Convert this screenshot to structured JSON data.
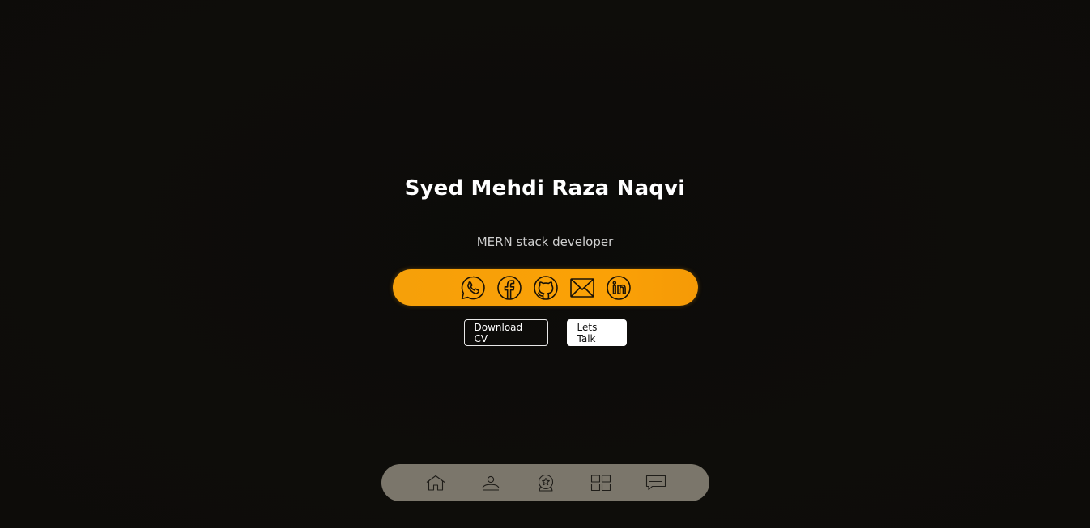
{
  "hero": {
    "name": "Syed Mehdi Raza Naqvi",
    "role": "MERN stack developer"
  },
  "social": {
    "accent_color": "#f9a007",
    "icons": [
      "whatsapp-icon",
      "facebook-icon",
      "github-icon",
      "mail-icon",
      "linkedin-icon"
    ]
  },
  "cta": {
    "download_label": "Download CV",
    "talk_label": "Lets Talk"
  },
  "nav": {
    "background_color": "#7b766b",
    "icons": [
      "home-icon",
      "user-icon",
      "award-icon",
      "portfolio-grid-icon",
      "message-icon"
    ]
  }
}
